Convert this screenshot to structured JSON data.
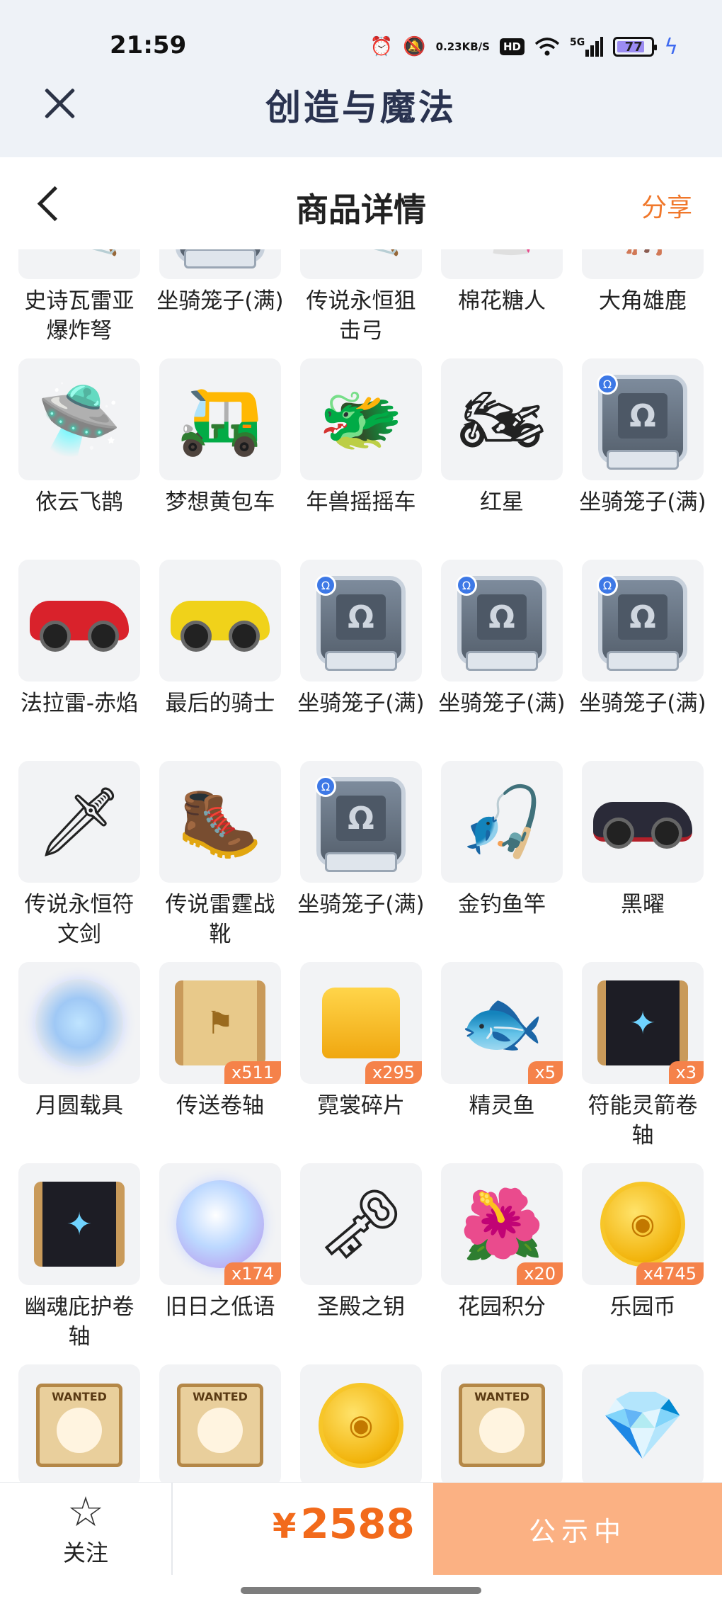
{
  "status_bar": {
    "time": "21:59",
    "net_speed_top": "0.23",
    "net_speed_bottom": "KB/S",
    "hd_label": "HD",
    "signal_label": "5G",
    "battery": "77"
  },
  "app_header": {
    "title": "创造与魔法"
  },
  "nav": {
    "title": "商品详情",
    "share": "分享"
  },
  "items": [
    {
      "name": "史诗瓦雷亚爆炸弩",
      "qty": null,
      "art": "crossbow"
    },
    {
      "name": "坐骑笼子(满)",
      "qty": null,
      "art": "cage"
    },
    {
      "name": "传说永恒狙击弓",
      "qty": null,
      "art": "bow"
    },
    {
      "name": "棉花糖人",
      "qty": null,
      "art": "creature"
    },
    {
      "name": "大角雄鹿",
      "qty": null,
      "art": "deer"
    },
    {
      "name": "依云飞鹊",
      "qty": null,
      "art": "drone"
    },
    {
      "name": "梦想黄包车",
      "qty": null,
      "art": "rickshaw"
    },
    {
      "name": "年兽摇摇车",
      "qty": null,
      "art": "dragon-cart"
    },
    {
      "name": "红星",
      "qty": null,
      "art": "motorbike"
    },
    {
      "name": "坐骑笼子(满)",
      "qty": null,
      "art": "cage"
    },
    {
      "name": "法拉雷-赤焰",
      "qty": null,
      "art": "red-car"
    },
    {
      "name": "最后的骑士",
      "qty": null,
      "art": "yellow-car"
    },
    {
      "name": "坐骑笼子(满)",
      "qty": null,
      "art": "cage"
    },
    {
      "name": "坐骑笼子(满)",
      "qty": null,
      "art": "cage"
    },
    {
      "name": "坐骑笼子(满)",
      "qty": null,
      "art": "cage"
    },
    {
      "name": "传说永恒符文剑",
      "qty": null,
      "art": "sword"
    },
    {
      "name": "传说雷霆战靴",
      "qty": null,
      "art": "boots"
    },
    {
      "name": "坐骑笼子(满)",
      "qty": null,
      "art": "cage"
    },
    {
      "name": "金钓鱼竿",
      "qty": null,
      "art": "fishing-rod"
    },
    {
      "name": "黑曜",
      "qty": null,
      "art": "black-car"
    },
    {
      "name": "月圆载具",
      "qty": null,
      "art": "cloud-orb"
    },
    {
      "name": "传送卷轴",
      "qty": "x511",
      "art": "teleport-scroll"
    },
    {
      "name": "霓裳碎片",
      "qty": "x295",
      "art": "shirt"
    },
    {
      "name": "精灵鱼",
      "qty": "x5",
      "art": "spirit-fish"
    },
    {
      "name": "符能灵箭卷轴",
      "qty": "x3",
      "art": "dark-scroll"
    },
    {
      "name": "幽魂庇护卷轴",
      "qty": null,
      "art": "dark-scroll"
    },
    {
      "name": "旧日之低语",
      "qty": "x174",
      "art": "orb"
    },
    {
      "name": "圣殿之钥",
      "qty": null,
      "art": "key"
    },
    {
      "name": "花园积分",
      "qty": "x20",
      "art": "flower"
    },
    {
      "name": "乐园币",
      "qty": "x4745",
      "art": "coin"
    },
    {
      "name": "",
      "qty": null,
      "art": "wanted"
    },
    {
      "name": "",
      "qty": null,
      "art": "wanted"
    },
    {
      "name": "",
      "qty": null,
      "art": "coin"
    },
    {
      "name": "",
      "qty": null,
      "art": "wanted"
    },
    {
      "name": "",
      "qty": null,
      "art": "crystal"
    }
  ],
  "bottom_bar": {
    "follow_label": "关注",
    "price_symbol": "¥",
    "price": "2588",
    "status_button": "公示中"
  }
}
